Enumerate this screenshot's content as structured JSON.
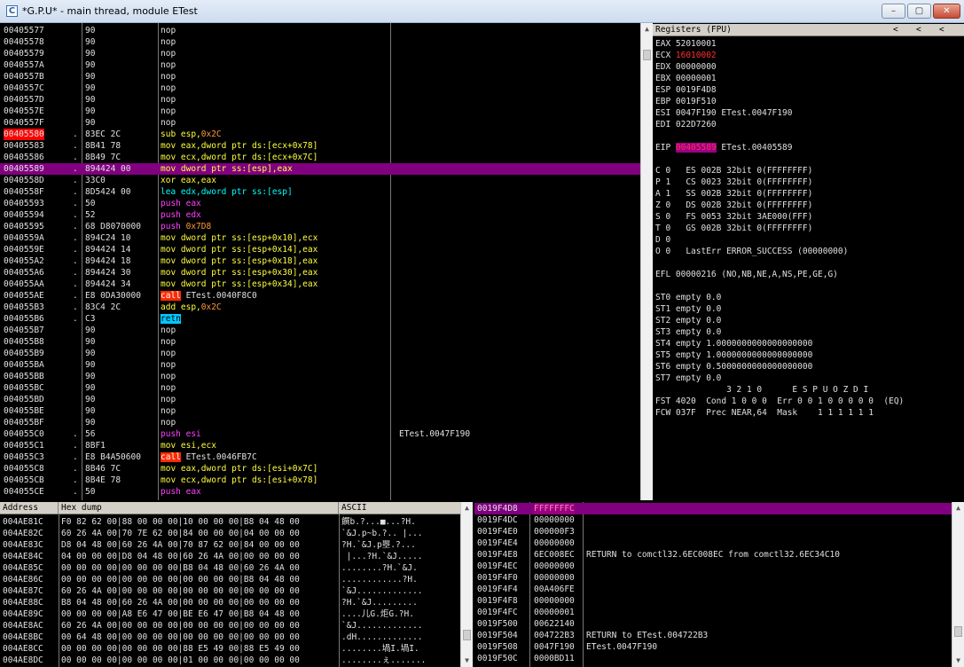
{
  "title": "*G.P.U* - main thread, module ETest",
  "app_icon": "C",
  "window_buttons": [
    "–",
    "▢",
    "✕"
  ],
  "disasm": [
    {
      "a": "00405577",
      "d": "",
      "h": "90",
      "i": [
        [
          "nop",
          "w"
        ]
      ],
      "c": ""
    },
    {
      "a": "00405578",
      "d": "",
      "h": "90",
      "i": [
        [
          "nop",
          "w"
        ]
      ],
      "c": ""
    },
    {
      "a": "00405579",
      "d": "",
      "h": "90",
      "i": [
        [
          "nop",
          "w"
        ]
      ],
      "c": ""
    },
    {
      "a": "0040557A",
      "d": "",
      "h": "90",
      "i": [
        [
          "nop",
          "w"
        ]
      ],
      "c": ""
    },
    {
      "a": "0040557B",
      "d": "",
      "h": "90",
      "i": [
        [
          "nop",
          "w"
        ]
      ],
      "c": ""
    },
    {
      "a": "0040557C",
      "d": "",
      "h": "90",
      "i": [
        [
          "nop",
          "w"
        ]
      ],
      "c": ""
    },
    {
      "a": "0040557D",
      "d": "",
      "h": "90",
      "i": [
        [
          "nop",
          "w"
        ]
      ],
      "c": ""
    },
    {
      "a": "0040557E",
      "d": "",
      "h": "90",
      "i": [
        [
          "nop",
          "w"
        ]
      ],
      "c": ""
    },
    {
      "a": "0040557F",
      "d": "",
      "h": "90",
      "i": [
        [
          "nop",
          "w"
        ]
      ],
      "c": ""
    },
    {
      "a": "00405580",
      "d": ".",
      "h": "83EC 2C",
      "i": [
        [
          "sub esp,",
          "y"
        ],
        [
          "0x2C",
          "o"
        ]
      ],
      "c": "",
      "bp": true
    },
    {
      "a": "00405583",
      "d": ".",
      "h": "8B41 78",
      "i": [
        [
          "mov eax,dword ptr ds:[ecx+0x78]",
          "y"
        ]
      ],
      "c": ""
    },
    {
      "a": "00405586",
      "d": ".",
      "h": "8B49 7C",
      "i": [
        [
          "mov ecx,dword ptr ds:[ecx+0x7C]",
          "y"
        ]
      ],
      "c": ""
    },
    {
      "a": "00405589",
      "d": ".",
      "h": "894424 00",
      "i": [
        [
          "mov dword ptr ss:[esp],eax",
          "y"
        ]
      ],
      "c": "",
      "cur": true
    },
    {
      "a": "0040558D",
      "d": ".",
      "h": "33C0",
      "i": [
        [
          "xor eax,eax",
          "y"
        ]
      ],
      "c": ""
    },
    {
      "a": "0040558F",
      "d": ".",
      "h": "8D5424 00",
      "i": [
        [
          "lea edx,dword ptr ss:[esp]",
          "c"
        ]
      ],
      "c": ""
    },
    {
      "a": "00405593",
      "d": ".",
      "h": "50",
      "i": [
        [
          "push eax",
          "m"
        ]
      ],
      "c": ""
    },
    {
      "a": "00405594",
      "d": ".",
      "h": "52",
      "i": [
        [
          "push edx",
          "m"
        ]
      ],
      "c": ""
    },
    {
      "a": "00405595",
      "d": ".",
      "h": "68 D8070000",
      "i": [
        [
          "push ",
          "m"
        ],
        [
          "0x7D8",
          "o"
        ]
      ],
      "c": ""
    },
    {
      "a": "0040559A",
      "d": ".",
      "h": "894C24 10",
      "i": [
        [
          "mov dword ptr ss:[esp+0x10],ecx",
          "y"
        ]
      ],
      "c": ""
    },
    {
      "a": "0040559E",
      "d": ".",
      "h": "894424 14",
      "i": [
        [
          "mov dword ptr ss:[esp+0x14],eax",
          "y"
        ]
      ],
      "c": ""
    },
    {
      "a": "004055A2",
      "d": ".",
      "h": "894424 18",
      "i": [
        [
          "mov dword ptr ss:[esp+0x18],eax",
          "y"
        ]
      ],
      "c": ""
    },
    {
      "a": "004055A6",
      "d": ".",
      "h": "894424 30",
      "i": [
        [
          "mov dword ptr ss:[esp+0x30],eax",
          "y"
        ]
      ],
      "c": ""
    },
    {
      "a": "004055AA",
      "d": ".",
      "h": "894424 34",
      "i": [
        [
          "mov dword ptr ss:[esp+0x34],eax",
          "y"
        ]
      ],
      "c": ""
    },
    {
      "a": "004055AE",
      "d": ".",
      "h": "E8 0DA30000",
      "i": [
        [
          "call",
          "call"
        ],
        [
          " ETest.0040F8C0",
          "w"
        ]
      ],
      "c": ""
    },
    {
      "a": "004055B3",
      "d": ".",
      "h": "83C4 2C",
      "i": [
        [
          "add esp,",
          "y"
        ],
        [
          "0x2C",
          "o"
        ]
      ],
      "c": ""
    },
    {
      "a": "004055B6",
      "d": ".",
      "h": "C3",
      "i": [
        [
          "retn",
          "ret"
        ]
      ],
      "c": ""
    },
    {
      "a": "004055B7",
      "d": "",
      "h": "90",
      "i": [
        [
          "nop",
          "w"
        ]
      ],
      "c": ""
    },
    {
      "a": "004055B8",
      "d": "",
      "h": "90",
      "i": [
        [
          "nop",
          "w"
        ]
      ],
      "c": ""
    },
    {
      "a": "004055B9",
      "d": "",
      "h": "90",
      "i": [
        [
          "nop",
          "w"
        ]
      ],
      "c": ""
    },
    {
      "a": "004055BA",
      "d": "",
      "h": "90",
      "i": [
        [
          "nop",
          "w"
        ]
      ],
      "c": ""
    },
    {
      "a": "004055BB",
      "d": "",
      "h": "90",
      "i": [
        [
          "nop",
          "w"
        ]
      ],
      "c": ""
    },
    {
      "a": "004055BC",
      "d": "",
      "h": "90",
      "i": [
        [
          "nop",
          "w"
        ]
      ],
      "c": ""
    },
    {
      "a": "004055BD",
      "d": "",
      "h": "90",
      "i": [
        [
          "nop",
          "w"
        ]
      ],
      "c": ""
    },
    {
      "a": "004055BE",
      "d": "",
      "h": "90",
      "i": [
        [
          "nop",
          "w"
        ]
      ],
      "c": ""
    },
    {
      "a": "004055BF",
      "d": "",
      "h": "90",
      "i": [
        [
          "nop",
          "w"
        ]
      ],
      "c": ""
    },
    {
      "a": "004055C0",
      "d": ".",
      "h": "56",
      "i": [
        [
          "push esi",
          "m"
        ]
      ],
      "c": "ETest.0047F190"
    },
    {
      "a": "004055C1",
      "d": ".",
      "h": "8BF1",
      "i": [
        [
          "mov esi,ecx",
          "y"
        ]
      ],
      "c": ""
    },
    {
      "a": "004055C3",
      "d": ".",
      "h": "E8 B4A50600",
      "i": [
        [
          "call",
          "call"
        ],
        [
          " ETest.0046FB7C",
          "w"
        ]
      ],
      "c": ""
    },
    {
      "a": "004055C8",
      "d": ".",
      "h": "8B46 7C",
      "i": [
        [
          "mov eax,dword ptr ds:[esi+0x7C]",
          "y"
        ]
      ],
      "c": ""
    },
    {
      "a": "004055CB",
      "d": ".",
      "h": "8B4E 78",
      "i": [
        [
          "mov ecx,dword ptr ds:[esi+0x78]",
          "y"
        ]
      ],
      "c": ""
    },
    {
      "a": "004055CE",
      "d": ".",
      "h": "50",
      "i": [
        [
          "push eax",
          "m"
        ]
      ],
      "c": ""
    }
  ],
  "registers": {
    "header": "Registers (FPU)",
    "nav": [
      "<",
      "<",
      "<"
    ],
    "lines": [
      [
        [
          "EAX 52010001",
          "w"
        ]
      ],
      [
        [
          "ECX ",
          "w"
        ],
        [
          "16010002",
          "r"
        ]
      ],
      [
        [
          "EDX 00000000",
          "w"
        ]
      ],
      [
        [
          "EBX 00000001",
          "w"
        ]
      ],
      [
        [
          "ESP 0019F4D8",
          "w"
        ]
      ],
      [
        [
          "EBP 0019F510",
          "w"
        ]
      ],
      [
        [
          "ESI 0047F190 ETest.0047F190",
          "w"
        ]
      ],
      [
        [
          "EDI 022D7260",
          "w"
        ]
      ],
      [
        [
          "",
          "w"
        ]
      ],
      [
        [
          "EIP ",
          "w"
        ],
        [
          "00405589",
          "eip"
        ],
        [
          " ETest.00405589",
          "w"
        ]
      ],
      [
        [
          "",
          "w"
        ]
      ],
      [
        [
          "C 0   ES 002B 32bit 0(FFFFFFFF)",
          "w"
        ]
      ],
      [
        [
          "P 1   CS 0023 32bit 0(FFFFFFFF)",
          "w"
        ]
      ],
      [
        [
          "A 1   SS 002B 32bit 0(FFFFFFFF)",
          "w"
        ]
      ],
      [
        [
          "Z 0   DS 002B 32bit 0(FFFFFFFF)",
          "w"
        ]
      ],
      [
        [
          "S 0   FS 0053 32bit 3AE000(FFF)",
          "w"
        ]
      ],
      [
        [
          "T 0   GS 002B 32bit 0(FFFFFFFF)",
          "w"
        ]
      ],
      [
        [
          "D 0",
          "w"
        ]
      ],
      [
        [
          "O 0   LastErr ERROR_SUCCESS (00000000)",
          "w"
        ]
      ],
      [
        [
          "",
          "w"
        ]
      ],
      [
        [
          "EFL 00000216 (NO,NB,NE,A,NS,PE,GE,G)",
          "w"
        ]
      ],
      [
        [
          "",
          "w"
        ]
      ],
      [
        [
          "ST0 empty 0.0",
          "w"
        ]
      ],
      [
        [
          "ST1 empty 0.0",
          "w"
        ]
      ],
      [
        [
          "ST2 empty 0.0",
          "w"
        ]
      ],
      [
        [
          "ST3 empty 0.0",
          "w"
        ]
      ],
      [
        [
          "ST4 empty 1.0000000000000000000",
          "w"
        ]
      ],
      [
        [
          "ST5 empty 1.0000000000000000000",
          "w"
        ]
      ],
      [
        [
          "ST6 empty 0.5000000000000000000",
          "w"
        ]
      ],
      [
        [
          "ST7 empty 0.0",
          "w"
        ]
      ],
      [
        [
          "              3 2 1 0      E S P U O Z D I",
          "w"
        ]
      ],
      [
        [
          "FST 4020  Cond 1 0 0 0  Err 0 0 1 0 0 0 0 0  (EQ)",
          "w"
        ]
      ],
      [
        [
          "FCW 037F  Prec NEAR,64  Mask    1 1 1 1 1 1",
          "w"
        ]
      ]
    ]
  },
  "dump": {
    "headers": [
      "Address",
      "Hex dump",
      "ASCII"
    ],
    "rows": [
      {
        "a": "004AE81C",
        "h": "F0 82 62 00|88 00 00 00|10 00 00 00|B8 04 48 00",
        "s": "饌b.?...■...?H."
      },
      {
        "a": "004AE82C",
        "h": "60 26 4A 00|70 7E 62 00|84 00 00 00|04 00 00 00",
        "s": "`&J.p~b.?.. |..."
      },
      {
        "a": "004AE83C",
        "h": "D8 04 48 00|60 26 4A 00|70 87 62 00|84 00 00 00",
        "s": "?H.`&J.p瞾.?..."
      },
      {
        "a": "004AE84C",
        "h": "04 00 00 00|D8 04 48 00|60 26 4A 00|00 00 00 00",
        "s": " |...?H.`&J....."
      },
      {
        "a": "004AE85C",
        "h": "00 00 00 00|00 00 00 00|B8 04 48 00|60 26 4A 00",
        "s": "........?H.`&J."
      },
      {
        "a": "004AE86C",
        "h": "00 00 00 00|00 00 00 00|00 00 00 00|B8 04 48 00",
        "s": "............?H."
      },
      {
        "a": "004AE87C",
        "h": "60 26 4A 00|00 00 00 00|00 00 00 00|00 00 00 00",
        "s": "`&J............."
      },
      {
        "a": "004AE88C",
        "h": "B8 04 48 00|60 26 4A 00|00 00 00 00|00 00 00 00",
        "s": "?H.`&J........."
      },
      {
        "a": "004AE89C",
        "h": "00 00 00 00|A8 E6 47 00|BE E6 47 00|B8 04 48 00",
        "s": "....儿G.炬G.?H."
      },
      {
        "a": "004AE8AC",
        "h": "60 26 4A 00|00 00 00 00|00 00 00 00|00 00 00 00",
        "s": "`&J............."
      },
      {
        "a": "004AE8BC",
        "h": "00 64 48 00|00 00 00 00|00 00 00 00|00 00 00 00",
        "s": ".dH............."
      },
      {
        "a": "004AE8CC",
        "h": "00 00 00 00|00 00 00 00|88 E5 49 00|88 E5 49 00",
        "s": "........堝I.堝I."
      },
      {
        "a": "004AE8DC",
        "h": "00 00 00 00|00 00 00 00|01 00 00 00|00 00 00 00",
        "s": "........ぇ......."
      }
    ]
  },
  "stack": [
    {
      "a": "0019F4D8",
      "v": "FFFFFFFC",
      "c": "",
      "cur": true
    },
    {
      "a": "0019F4DC",
      "v": "00000000",
      "c": ""
    },
    {
      "a": "0019F4E0",
      "v": "000000F3",
      "c": ""
    },
    {
      "a": "0019F4E4",
      "v": "00000000",
      "c": ""
    },
    {
      "a": "0019F4E8",
      "v": "6EC008EC",
      "c": "RETURN to comctl32.6EC008EC from comctl32.6EC34C10"
    },
    {
      "a": "0019F4EC",
      "v": "00000000",
      "c": ""
    },
    {
      "a": "0019F4F0",
      "v": "00000000",
      "c": ""
    },
    {
      "a": "0019F4F4",
      "v": "00A406FE",
      "c": ""
    },
    {
      "a": "0019F4F8",
      "v": "00000000",
      "c": ""
    },
    {
      "a": "0019F4FC",
      "v": "00000001",
      "c": ""
    },
    {
      "a": "0019F500",
      "v": "00622140",
      "c": ""
    },
    {
      "a": "0019F504",
      "v": "004722B3",
      "c": "RETURN to ETest.004722B3"
    },
    {
      "a": "0019F508",
      "v": "0047F190",
      "c": "ETest.0047F190"
    },
    {
      "a": "0019F50C",
      "v": "0000BD11",
      "c": ""
    }
  ],
  "colors": {
    "w": "#e0e0e0",
    "y": "#ffff40",
    "c": "#00ffff",
    "m": "#ff40ff",
    "o": "#ff9a3c",
    "r": "#ff3030",
    "call_bg": "#ff2a00",
    "ret_bg": "#00c8ff",
    "cur_bg": "#800080",
    "bp_bg": "#ff0000",
    "eip_bg": "#9a0080",
    "eip_fg": "#ff2a6a"
  }
}
